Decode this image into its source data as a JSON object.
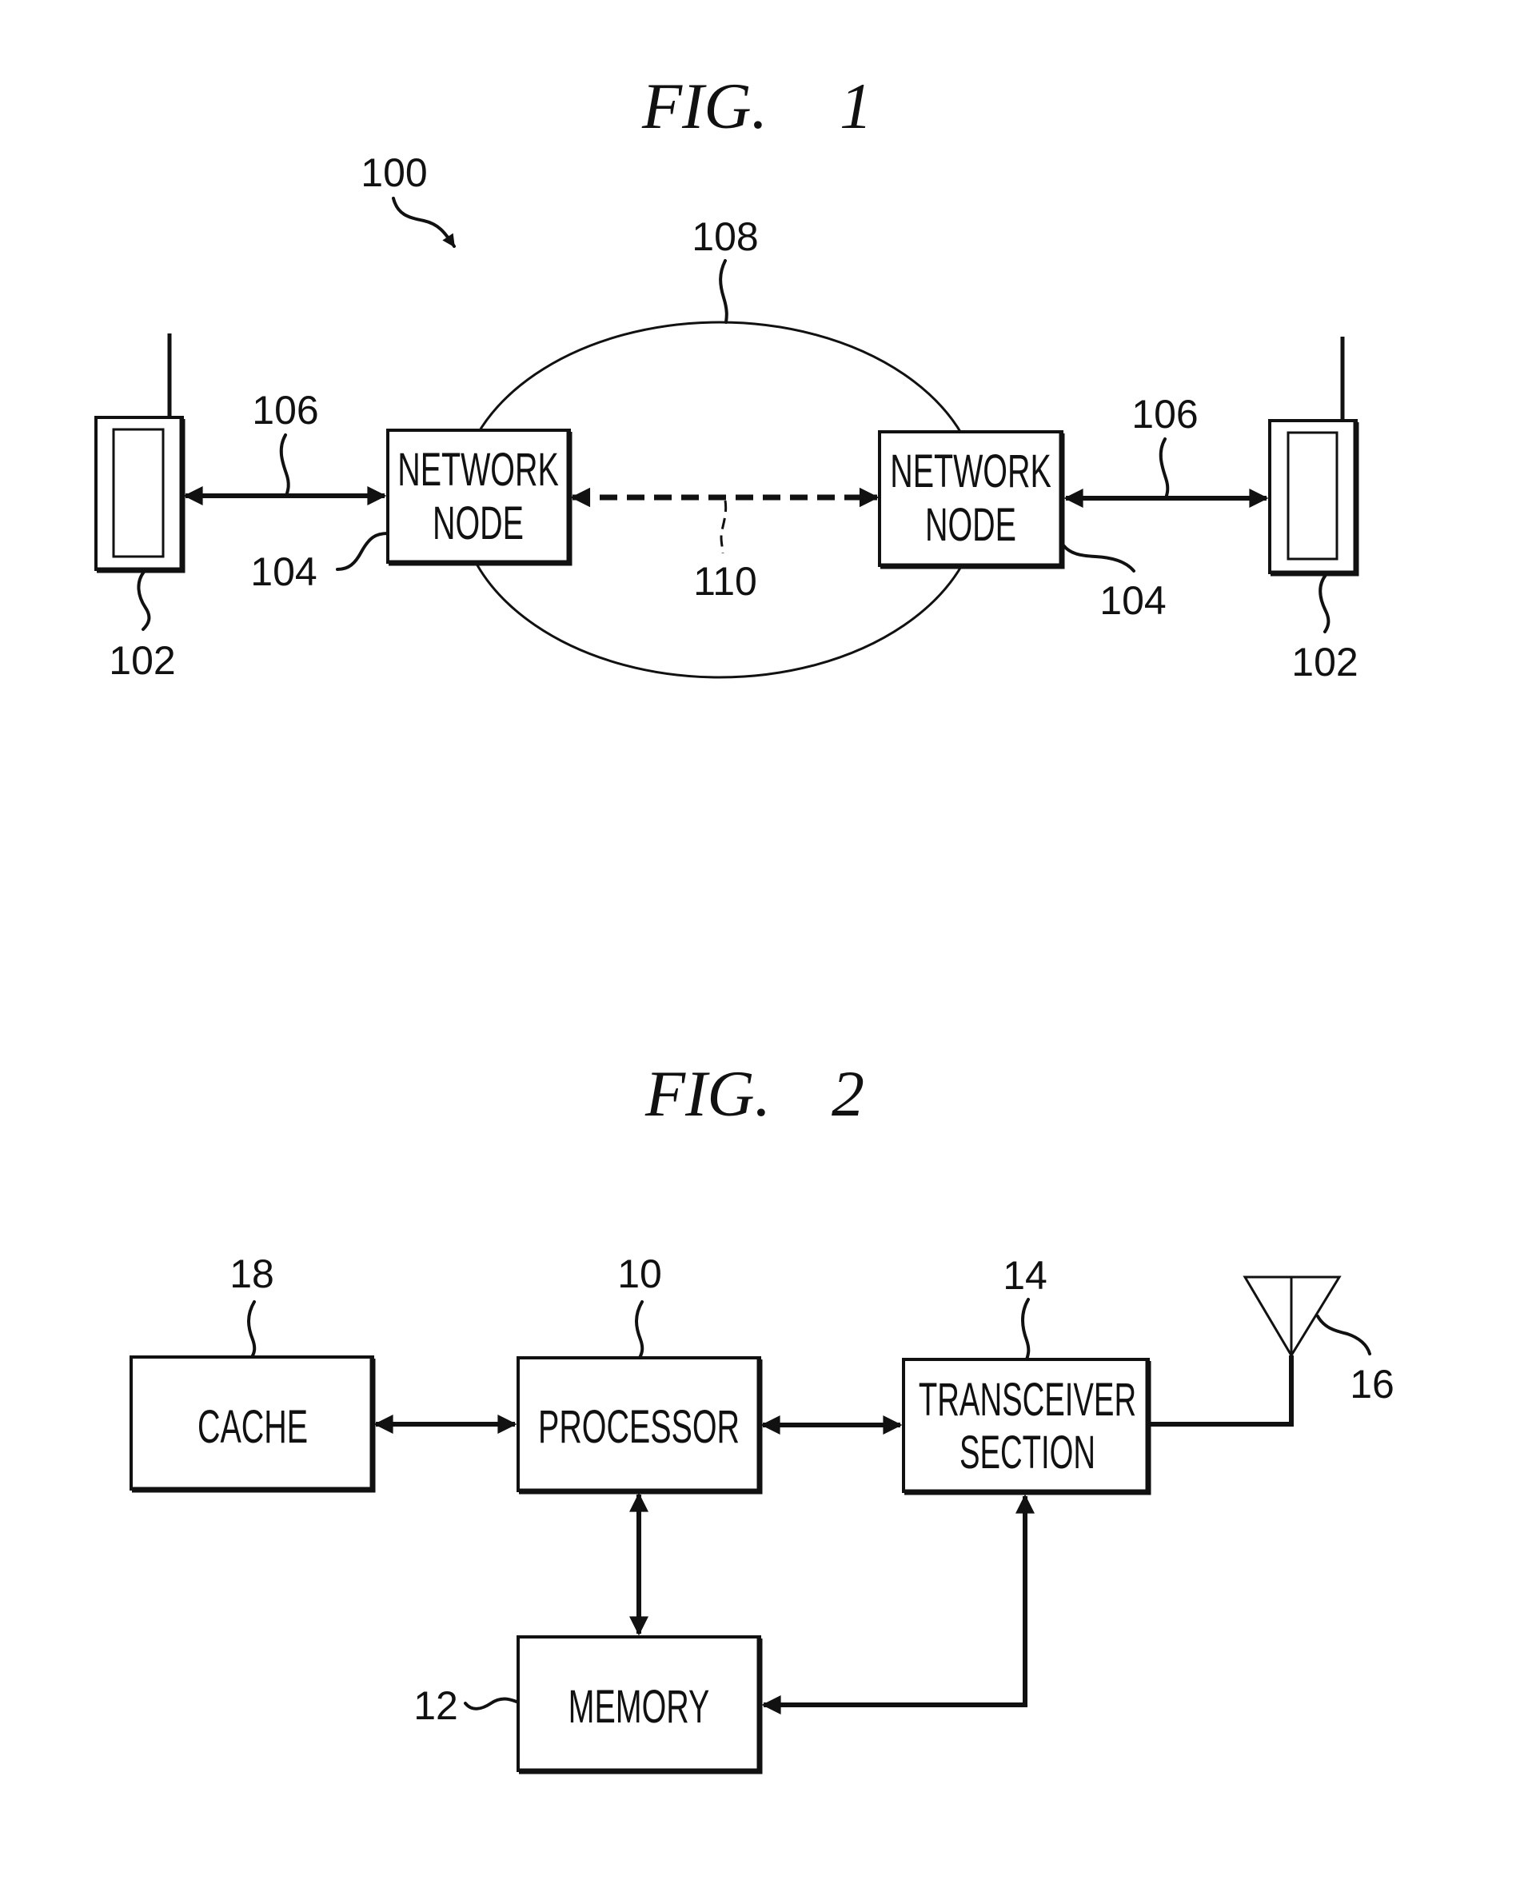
{
  "figures": [
    {
      "title": "FIG.  1",
      "title_parts": {
        "prefix": "FIG.",
        "number": "1"
      },
      "system_ref": "100",
      "network_ref": "108",
      "nodes": [
        {
          "ref": "104",
          "label_line1": "NETWORK",
          "label_line2": "NODE"
        },
        {
          "ref": "104",
          "label_line1": "NETWORK",
          "label_line2": "NODE"
        }
      ],
      "terminals": [
        {
          "ref": "102"
        },
        {
          "ref": "102"
        }
      ],
      "links": [
        {
          "ref": "106",
          "style": "solid",
          "direction": "bidirectional",
          "between": [
            "terminal-left",
            "node-left"
          ]
        },
        {
          "ref": "110",
          "style": "dashed",
          "direction": "bidirectional",
          "between": [
            "node-left",
            "node-right"
          ]
        },
        {
          "ref": "106",
          "style": "solid",
          "direction": "bidirectional",
          "between": [
            "node-right",
            "terminal-right"
          ]
        }
      ]
    },
    {
      "title": "FIG.  2",
      "title_parts": {
        "prefix": "FIG.",
        "number": "2"
      },
      "blocks": [
        {
          "id": "cache",
          "ref": "18",
          "label": "CACHE"
        },
        {
          "id": "processor",
          "ref": "10",
          "label": "PROCESSOR"
        },
        {
          "id": "transceiver",
          "ref": "14",
          "label_line1": "TRANSCEIVER",
          "label_line2": "SECTION"
        },
        {
          "id": "memory",
          "ref": "12",
          "label": "MEMORY"
        }
      ],
      "antenna": {
        "ref": "16"
      },
      "connections": [
        {
          "from": "cache",
          "to": "processor",
          "direction": "bidirectional"
        },
        {
          "from": "processor",
          "to": "transceiver",
          "direction": "bidirectional"
        },
        {
          "from": "processor",
          "to": "memory",
          "direction": "bidirectional"
        },
        {
          "from": "memory",
          "to": "transceiver",
          "direction": "bidirectional"
        },
        {
          "from": "transceiver",
          "to": "antenna",
          "direction": "none"
        }
      ]
    }
  ],
  "colors": {
    "ink": "#111111",
    "paper": "#ffffff"
  }
}
